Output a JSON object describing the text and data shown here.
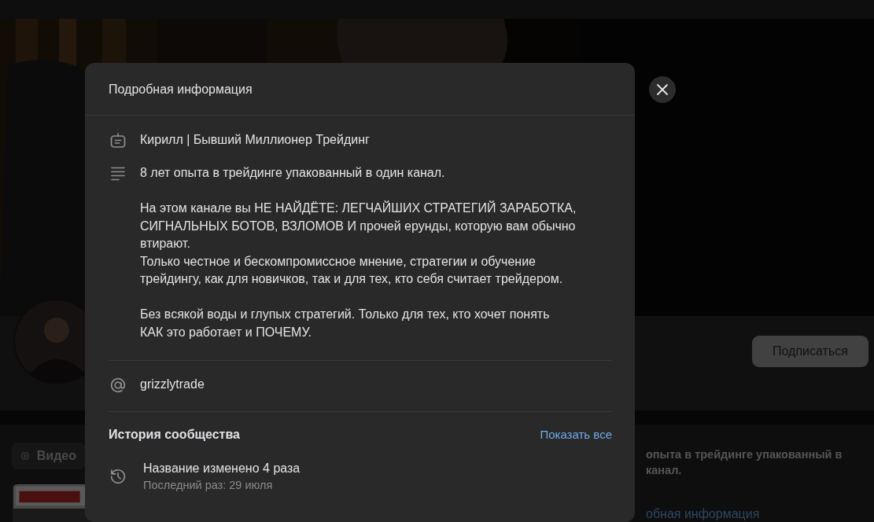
{
  "page": {
    "subscribe_button": "Подписаться",
    "tabs": [
      {
        "label": "Видео",
        "kind": "video"
      }
    ],
    "about_excerpt": "опыта в трейдинге упакованный в\nканал.",
    "details_link": "обная информация"
  },
  "modal": {
    "title": "Подробная информация",
    "rows": [
      {
        "kind": "name",
        "text": "Кирилл | Бывший Миллионер Трейдинг"
      },
      {
        "kind": "description",
        "text": "8 лет опыта в трейдинге упакованный в один канал.\n\nНа этом канале вы НЕ НАЙДЁТЕ: ЛЕГЧАЙШИХ СТРАТЕГИЙ ЗАРАБОТКА,\nСИГНАЛЬНЫХ БОТОВ, ВЗЛОМОВ И прочей ерунды, которую вам обычно\nвтирают.\nТолько честное и бескомпромиссное мнение, стратегии и обучение\nтрейдингу, как для новичков, так и для тех, кто себя считает трейдером.\n\nБез всякой воды и глупых стратегий. Только для тех, кто хочет понять\nКАК это работает и ПОЧЕМУ."
      },
      {
        "kind": "handle",
        "text": "grizzlytrade"
      }
    ],
    "history": {
      "title": "История сообщества",
      "show_all": "Показать все",
      "items": [
        {
          "title": "Название изменено 4 раза",
          "subtitle": "Последний раз: 29 июля"
        }
      ]
    }
  }
}
